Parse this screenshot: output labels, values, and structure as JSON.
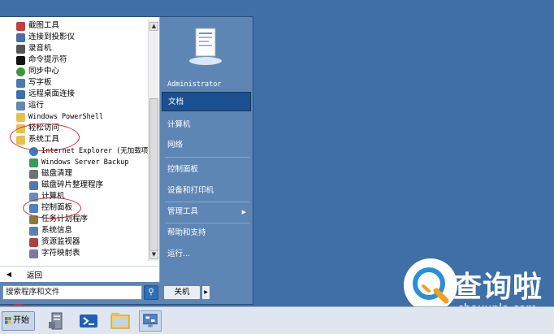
{
  "start_menu": {
    "programs": [
      {
        "label": "截图工具",
        "icon": "scissors-icon",
        "color": "#c04040"
      },
      {
        "label": "连接到投影仪",
        "icon": "projector-icon",
        "color": "#4a6fa0"
      },
      {
        "label": "录音机",
        "icon": "microphone-icon",
        "color": "#555555"
      },
      {
        "label": "命令提示符",
        "icon": "command-prompt-icon",
        "color": "#111111"
      },
      {
        "label": "同步中心",
        "icon": "sync-icon",
        "color": "#3a9a3a"
      },
      {
        "label": "写字板",
        "icon": "wordpad-icon",
        "color": "#4c78b0"
      },
      {
        "label": "远程桌面连接",
        "icon": "remote-desktop-icon",
        "color": "#3d6fa8"
      },
      {
        "label": "运行",
        "icon": "run-icon",
        "color": "#6688aa"
      },
      {
        "label": "Windows PowerShell",
        "icon": "folder-icon",
        "color": "#e8c050"
      },
      {
        "label": "轻松访问",
        "icon": "folder-icon",
        "color": "#e8c050"
      },
      {
        "label": "系统工具",
        "icon": "folder-icon",
        "color": "#e8c050"
      },
      {
        "label": "Internet Explorer (无加载项)",
        "icon": "ie-icon",
        "color": "#2a7fd0"
      },
      {
        "label": "Windows Server Backup",
        "icon": "backup-icon",
        "color": "#3a9a5a"
      },
      {
        "label": "磁盘清理",
        "icon": "disk-cleanup-icon",
        "color": "#707070"
      },
      {
        "label": "磁盘碎片整理程序",
        "icon": "defrag-icon",
        "color": "#5577aa"
      },
      {
        "label": "计算机",
        "icon": "computer-icon",
        "color": "#6a8cb5"
      },
      {
        "label": "控制面板",
        "icon": "control-panel-icon",
        "color": "#4d82c4"
      },
      {
        "label": "任务计划程序",
        "icon": "task-scheduler-icon",
        "color": "#8a7a40"
      },
      {
        "label": "系统信息",
        "icon": "system-info-icon",
        "color": "#5a7fb0"
      },
      {
        "label": "资源监视器",
        "icon": "resource-monitor-icon",
        "color": "#b04040"
      },
      {
        "label": "字符映射表",
        "icon": "character-map-icon",
        "color": "#7a7aa0"
      }
    ],
    "back_label": "返回",
    "search_placeholder": "搜索程序和文件",
    "user_name": "Administrator",
    "right_items": [
      {
        "label": "文档",
        "active": true
      },
      {
        "label": "计算机",
        "active": false
      },
      {
        "label": "网络",
        "active": false
      },
      {
        "label": "控制面板",
        "active": false
      },
      {
        "label": "设备和打印机",
        "active": false
      },
      {
        "label": "管理工具",
        "active": false,
        "submenu": true
      },
      {
        "label": "帮助和支持",
        "active": false
      },
      {
        "label": "运行...",
        "active": false
      }
    ],
    "shutdown_label": "关机"
  },
  "taskbar": {
    "start_label": "开始",
    "pinned": [
      "server-manager-icon",
      "powershell-icon",
      "explorer-icon",
      "control-panel-icon"
    ]
  },
  "watermark": {
    "title": "查询啦",
    "subtitle": "chaxunla.com"
  },
  "colors": {
    "desktop": "#3f6fa7",
    "menu_right": "#5e86b5",
    "highlight": "#1c4f8f",
    "annotation": "#d03030"
  }
}
